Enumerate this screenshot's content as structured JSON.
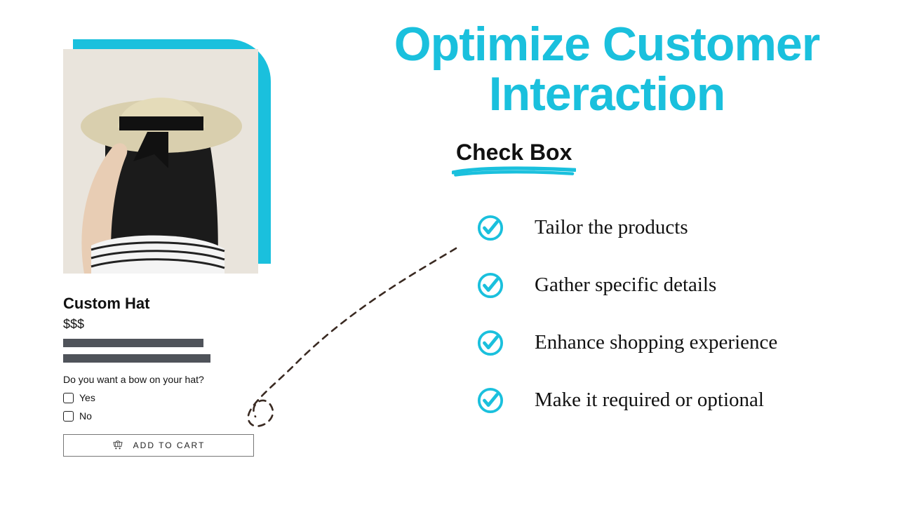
{
  "headline": {
    "line1": "Optimize Customer",
    "line2": "Interaction"
  },
  "subhead": "Check Box",
  "features": [
    {
      "text": "Tailor the products"
    },
    {
      "text": "Gather specific details"
    },
    {
      "text": "Enhance shopping experience"
    },
    {
      "text": "Make it required or optional"
    }
  ],
  "product": {
    "title": "Custom Hat",
    "price": "$$$",
    "question": "Do you want a bow on your hat?",
    "options": {
      "yes": "Yes",
      "no": "No"
    },
    "cta": "ADD TO CART"
  },
  "colors": {
    "accent": "#1ac0dd",
    "dashed": "#3a2a22"
  }
}
